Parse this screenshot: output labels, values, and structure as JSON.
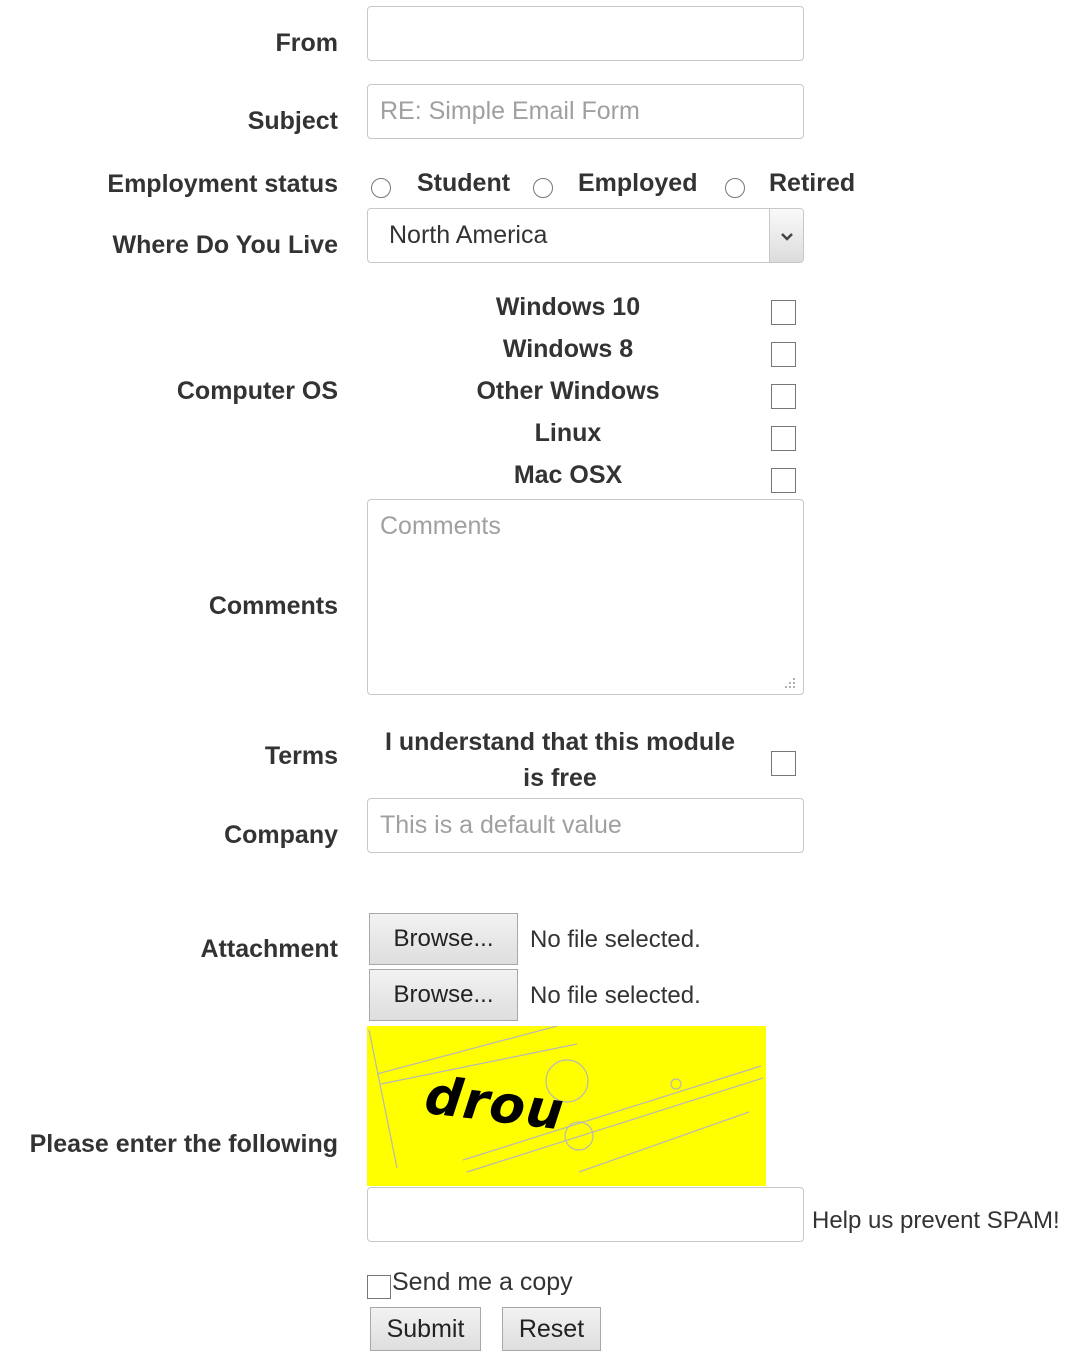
{
  "labels": {
    "from": "From",
    "subject": "Subject",
    "employment": "Employment status",
    "where_live": "Where Do You Live",
    "computer_os": "Computer OS",
    "comments": "Comments",
    "terms": "Terms",
    "company": "Company",
    "attachment": "Attachment",
    "captcha": "Please enter the following"
  },
  "fields": {
    "from_value": "",
    "subject_placeholder": "RE: Simple Email Form",
    "comments_placeholder": "Comments",
    "company_placeholder": "This is a default value",
    "captcha_value": ""
  },
  "employment_options": [
    "Student",
    "Employed",
    "Retired"
  ],
  "location_selected": "North America",
  "os_options": [
    "Windows 10",
    "Windows 8",
    "Other Windows",
    "Linux",
    "Mac OSX"
  ],
  "terms_text_line1": "I understand that this module",
  "terms_text_line2": "is free",
  "attachments": [
    {
      "button": "Browse...",
      "status": "No file selected."
    },
    {
      "button": "Browse...",
      "status": "No file selected."
    }
  ],
  "captcha_word": "drou",
  "captcha_help": "Help us prevent SPAM!",
  "send_copy_label": "Send me a copy",
  "buttons": {
    "submit": "Submit",
    "reset": "Reset"
  },
  "colors": {
    "captcha_bg": "#ffff00",
    "label_text": "#333333",
    "placeholder": "#a0a0a0"
  }
}
